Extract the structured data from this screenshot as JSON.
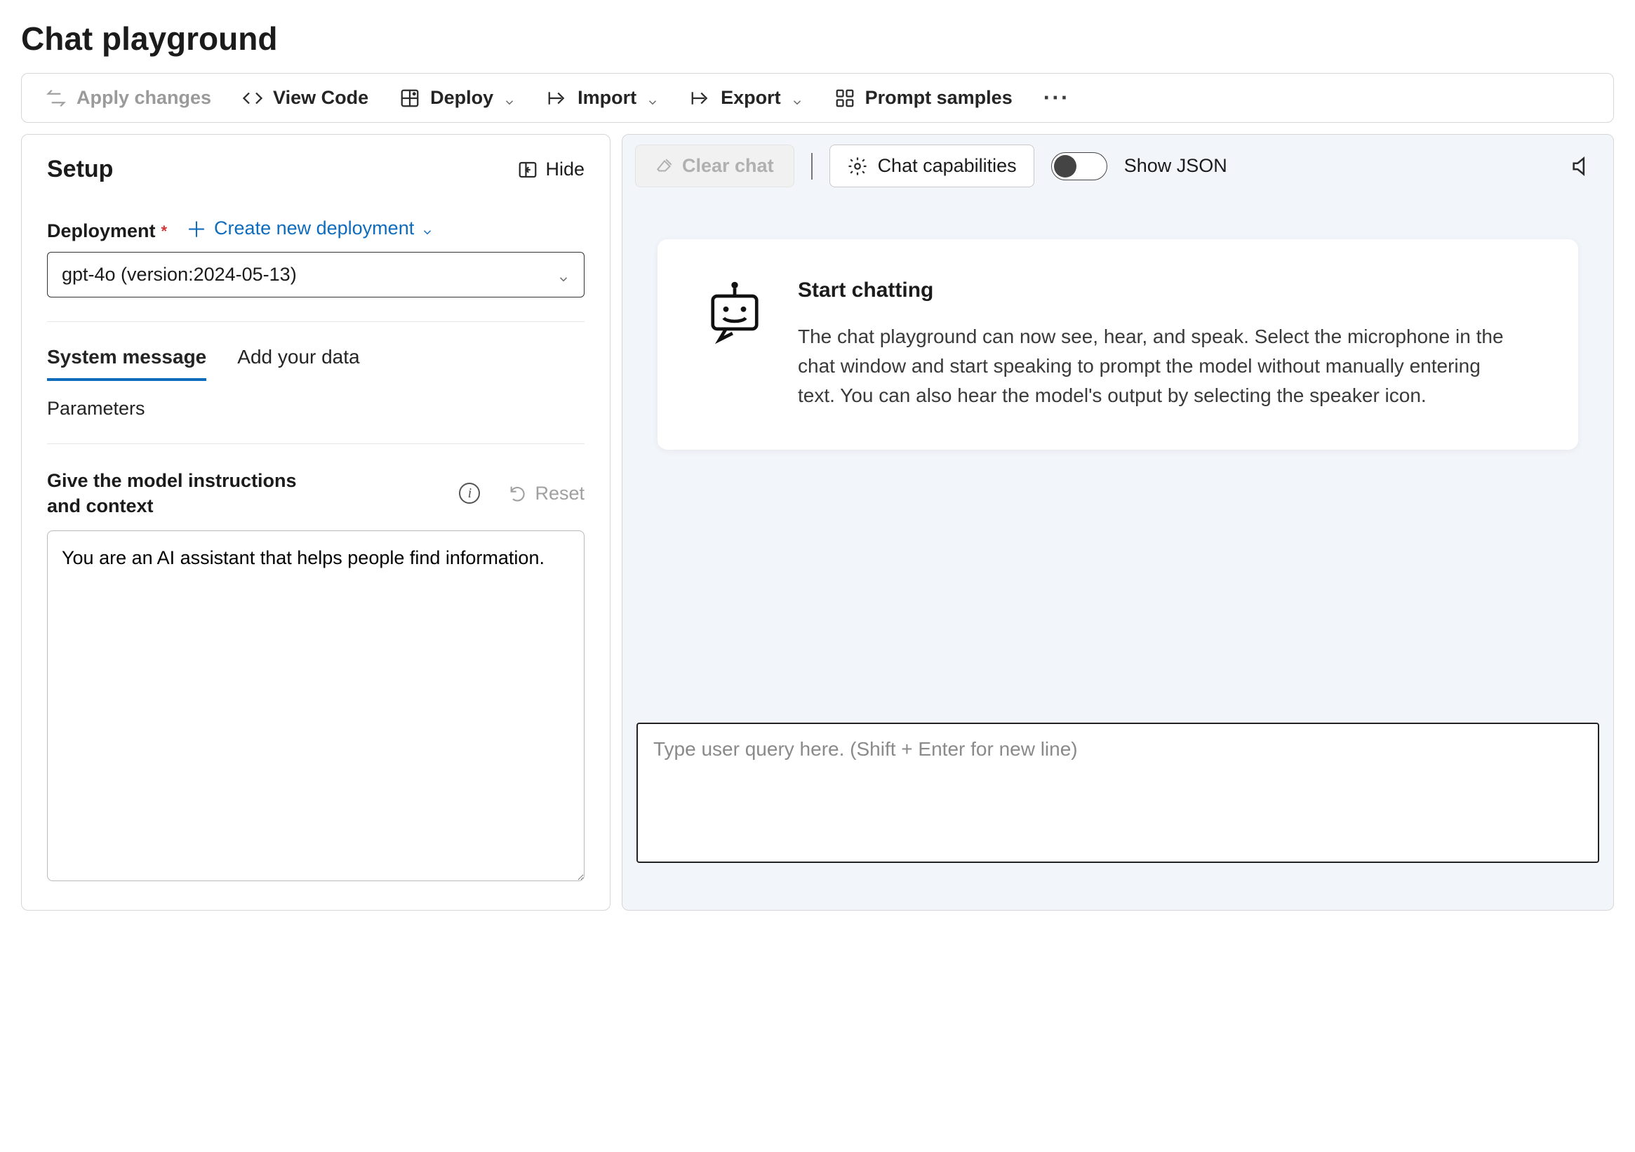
{
  "page": {
    "title": "Chat playground"
  },
  "toolbar": {
    "apply": "Apply changes",
    "viewCode": "View Code",
    "deploy": "Deploy",
    "import": "Import",
    "export": "Export",
    "samples": "Prompt samples"
  },
  "setup": {
    "title": "Setup",
    "hide": "Hide",
    "deploymentLabel": "Deployment",
    "createNew": "Create new deployment",
    "selected": "gpt-4o (version:2024-05-13)",
    "tabs": {
      "system": "System message",
      "data": "Add your data"
    },
    "parameters": "Parameters",
    "instructLabel": "Give the model instructions and context",
    "reset": "Reset",
    "systemMessage": "You are an AI assistant that helps people find information."
  },
  "chat": {
    "clear": "Clear chat",
    "capabilities": "Chat capabilities",
    "showJson": "Show JSON",
    "welcomeTitle": "Start chatting",
    "welcomeBody": "The chat playground can now see, hear, and speak. Select the microphone in the chat window and start speaking to prompt the model without manually entering text. You can also hear the model's output by selecting the speaker icon.",
    "inputPlaceholder": "Type user query here. (Shift + Enter for new line)"
  }
}
